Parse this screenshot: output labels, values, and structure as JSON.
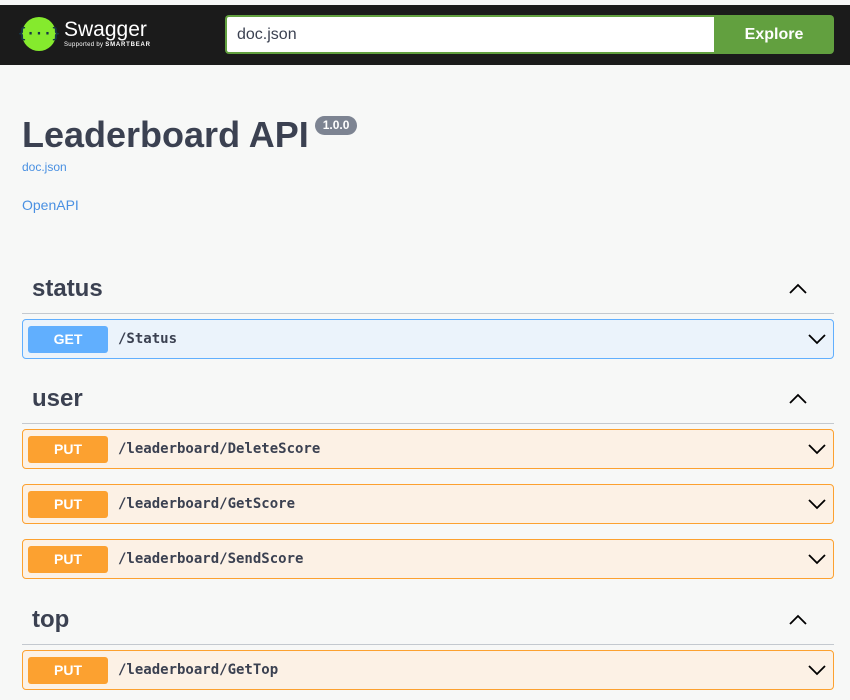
{
  "topbar": {
    "logo_name": "Swagger",
    "logo_tagline_prefix": "Supported by",
    "logo_tagline_brand": "SMARTBEAR",
    "logo_icon": "swagger-logo-icon",
    "search_value": "doc.json",
    "explore_label": "Explore"
  },
  "info": {
    "title": "Leaderboard API",
    "version": "1.0.0",
    "doc_link": "doc.json",
    "openapi_link": "OpenAPI"
  },
  "colors": {
    "get": "#61affe",
    "put": "#fca130",
    "topbar_bg": "#1b1b1b",
    "explore_bg": "#62a03f",
    "link": "#4990e2"
  },
  "tags": [
    {
      "name": "status",
      "expanded": true,
      "operations": [
        {
          "method": "GET",
          "path": "/Status"
        }
      ]
    },
    {
      "name": "user",
      "expanded": true,
      "operations": [
        {
          "method": "PUT",
          "path": "/leaderboard/DeleteScore"
        },
        {
          "method": "PUT",
          "path": "/leaderboard/GetScore"
        },
        {
          "method": "PUT",
          "path": "/leaderboard/SendScore"
        }
      ]
    },
    {
      "name": "top",
      "expanded": true,
      "operations": [
        {
          "method": "PUT",
          "path": "/leaderboard/GetTop"
        }
      ]
    }
  ]
}
